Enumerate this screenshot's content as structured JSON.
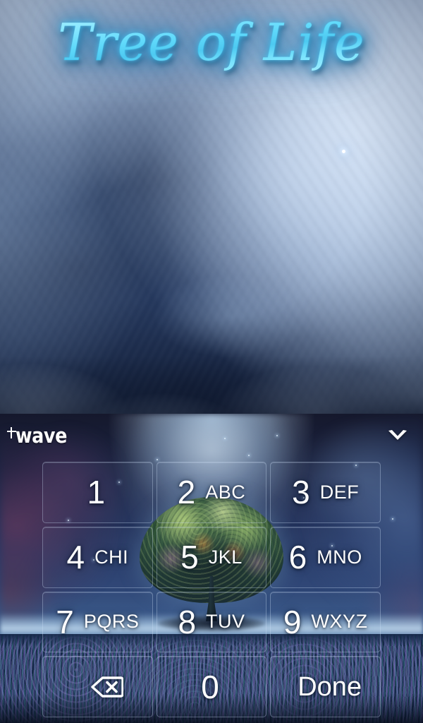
{
  "app": {
    "title": "Tree of Life",
    "theme_accent": "#3fc8f5",
    "key_text_color": "#ffffff"
  },
  "wallpaper": {
    "scene": "storm-clouds-night-sky",
    "sky_color": "#2e456e",
    "cloud_highlight_color": "#d6e4f6"
  },
  "keyboard": {
    "toolbar": {
      "brand_label": "wave",
      "brand_icon": "sparkle-icon",
      "collapse_icon": "chevron-down-icon"
    },
    "background": {
      "scene": "tree-of-life-meadow",
      "horizon_color": "#d6eeff",
      "meadow_color": "#24406c"
    },
    "keys": [
      {
        "name": "key-1",
        "digit": "1",
        "letters": ""
      },
      {
        "name": "key-2",
        "digit": "2",
        "letters": "ABC"
      },
      {
        "name": "key-3",
        "digit": "3",
        "letters": "DEF"
      },
      {
        "name": "key-4",
        "digit": "4",
        "letters": "CHI"
      },
      {
        "name": "key-5",
        "digit": "5",
        "letters": "JKL"
      },
      {
        "name": "key-6",
        "digit": "6",
        "letters": "MNO"
      },
      {
        "name": "key-7",
        "digit": "7",
        "letters": "PQRS"
      },
      {
        "name": "key-8",
        "digit": "8",
        "letters": "TUV"
      },
      {
        "name": "key-9",
        "digit": "9",
        "letters": "WXYZ"
      },
      {
        "name": "key-backspace",
        "digit": "",
        "letters": "",
        "icon": "backspace-icon"
      },
      {
        "name": "key-0",
        "digit": "0",
        "letters": ""
      },
      {
        "name": "key-done",
        "digit": "",
        "letters": "",
        "label": "Done"
      }
    ]
  }
}
